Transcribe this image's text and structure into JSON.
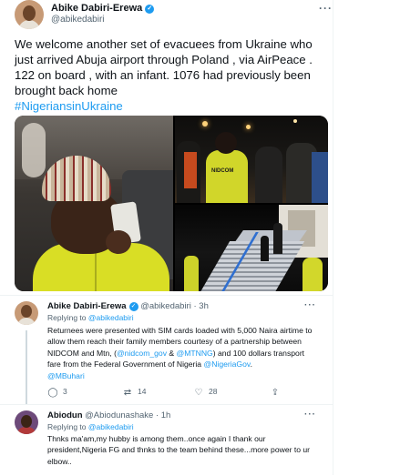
{
  "main_tweet": {
    "author_name": "Abike Dabiri-Erewa",
    "author_handle": "@abikedabiri",
    "text_part1": "We welcome another set of evacuees from Ukraine who just arrived Abuja airport  through Poland , via AirPeace . 122 on board , with an infant. 1076 had previously been brought back home",
    "hashtag": "#NigeriansinUkraine",
    "vest_text": "NIDCOM"
  },
  "reply1": {
    "author_name": "Abike Dabiri-Erewa",
    "author_handle": "@abikedabiri",
    "separator": "·",
    "time": "3h",
    "replying_label": "Replying to",
    "replying_handle": "@abikedabiri",
    "text_a": "Returnees were presented with SIM cards loaded with 5,000 Naira airtime to allow them reach their family members courtesy of a partnership between NIDCOM and Mtn, (",
    "mention1": "@nidcom_gov",
    "amp": " & ",
    "mention2": "@MTNNG",
    "text_b": ") and 100 dollars transport fare from the Federal Government of Nigeria ",
    "mention3": "@NigeriaGov",
    "text_c": ".",
    "mention4": "@MBuhari",
    "replies": "3",
    "retweets": "14",
    "likes": "28"
  },
  "reply2": {
    "author_name": "Abiodun",
    "author_handle": "@Abiodunashake",
    "separator": "·",
    "time": "1h",
    "replying_label": "Replying to",
    "replying_handle": "@abikedabiri",
    "text": "Thnks ma'am,my hubby is among them..once again I thank our president,Nigeria FG and thnks to the team behind these...more power to ur elbow.."
  },
  "icons": {
    "more": "more-options-icon",
    "verified": "verified-badge-icon",
    "reply": "reply-icon",
    "retweet": "retweet-icon",
    "like": "like-icon",
    "share": "share-icon"
  },
  "colors": {
    "accent": "#1d9bf0",
    "text": "#0f1419",
    "muted": "#536471"
  }
}
